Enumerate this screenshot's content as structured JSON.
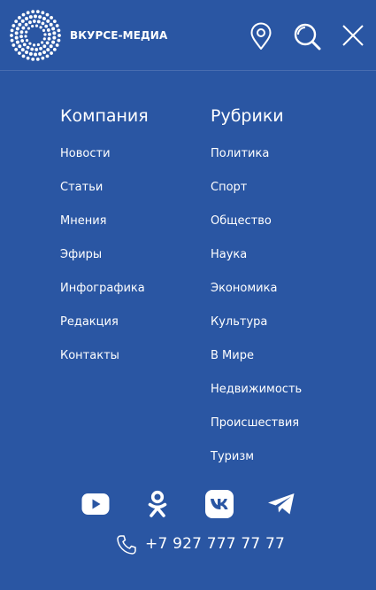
{
  "header": {
    "brand": "ВКУРСЕ-МЕДИА",
    "logo_icon": "dotted-circle-logo",
    "location_icon": "map-pin-icon",
    "search_icon": "search-icon",
    "close_icon": "close-icon"
  },
  "company": {
    "title": "Компания",
    "items": [
      "Новости",
      "Статьи",
      "Мнения",
      "Эфиры",
      "Инфографика",
      "Редакция",
      "Контакты"
    ]
  },
  "rubrics": {
    "title": "Рубрики",
    "items": [
      "Политика",
      "Спорт",
      "Общество",
      "Наука",
      "Экономика",
      "Культура",
      "В Мире",
      "Недвижимость",
      "Происшествия",
      "Туризм"
    ]
  },
  "social": [
    "youtube-icon",
    "odnoklassniki-icon",
    "vk-icon",
    "telegram-icon"
  ],
  "contact": {
    "phone": "+7 927 777 77 77",
    "phone_icon": "phone-icon"
  },
  "colors": {
    "background": "#2a56a3",
    "foreground": "#ffffff"
  }
}
